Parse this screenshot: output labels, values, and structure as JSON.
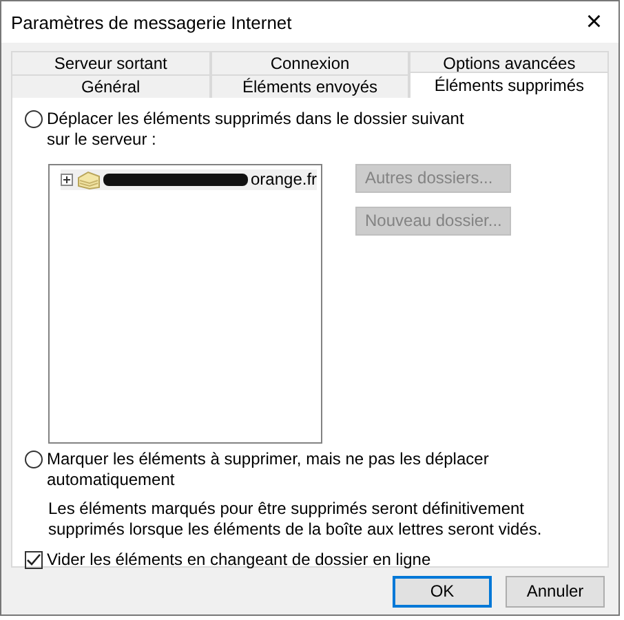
{
  "window": {
    "title": "Paramètres de messagerie Internet",
    "close": "×"
  },
  "tab_rows": [
    [
      {
        "label": "Serveur sortant",
        "selected": false
      },
      {
        "label": "Connexion",
        "selected": false
      },
      {
        "label": "Options avancées",
        "selected": false
      }
    ],
    [
      {
        "label": "Général",
        "selected": false
      },
      {
        "label": "Éléments envoyés",
        "selected": false
      },
      {
        "label": "Éléments supprimés",
        "selected": true
      }
    ]
  ],
  "move_option": {
    "label": "Déplacer les éléments supprimés dans le dossier suivant sur le serveur :",
    "selected": false
  },
  "folder_tree": [
    {
      "label": "orange.fr",
      "expanded": false,
      "redacted": true
    }
  ],
  "folder_buttons": [
    {
      "label": "Autres dossiers...",
      "disabled": true
    },
    {
      "label": "Nouveau dossier...",
      "disabled": true
    }
  ],
  "mark_option": {
    "label": "Marquer les éléments à supprimer, mais ne pas les déplacer automatiquement",
    "selected": false
  },
  "mark_note": "Les éléments marqués pour être supprimés seront définitivement supprimés lorsque les éléments de la boîte aux lettres seront vidés.",
  "purge_option": {
    "label": "Vider les éléments en changeant de dossier en ligne",
    "checked": true
  },
  "buttons": [
    {
      "label": "OK",
      "default": true
    },
    {
      "label": "Annuler",
      "default": false
    }
  ]
}
